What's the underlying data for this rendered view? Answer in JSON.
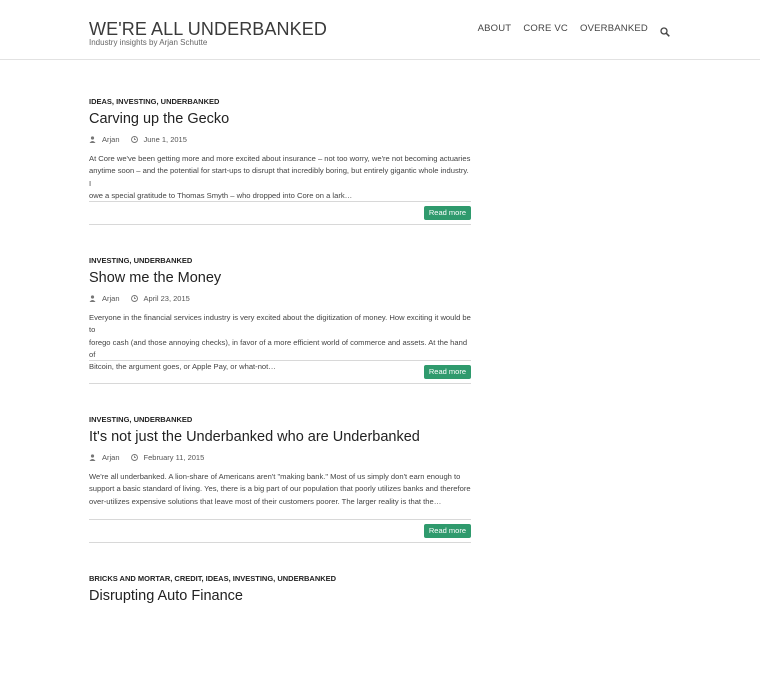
{
  "site": {
    "title": "WE'RE ALL UNDERBANKED",
    "tagline": "Industry insights by Arjan Schutte"
  },
  "nav": {
    "items": [
      "ABOUT",
      "CORE VC",
      "OVERBANKED"
    ],
    "search_icon": "search-icon"
  },
  "posts": [
    {
      "categories": "IDEAS, INVESTING, UNDERBANKED",
      "title": "Carving up the Gecko",
      "author": "Arjan",
      "date": "June 1, 2015",
      "excerpt_lines": [
        "At Core we've been getting more and more excited about insurance – not too worry, we're not becoming actuaries",
        "anytime soon – and the potential for start-ups to disrupt that incredibly boring, but entirely gigantic whole industry. I",
        "owe a special gratitude to Thomas Smyth – who dropped into Core on a lark…"
      ],
      "read_more": "Read more"
    },
    {
      "categories": "INVESTING, UNDERBANKED",
      "title": "Show me the Money",
      "author": "Arjan",
      "date": "April 23, 2015",
      "excerpt_lines": [
        "Everyone in the financial services industry is very excited about the digitization of money.  How exciting it would be to",
        "forego cash (and those annoying checks), in favor of a more efficient world of commerce and assets.  At the hand of",
        "Bitcoin, the argument goes, or Apple Pay, or what-not…"
      ],
      "read_more": "Read more"
    },
    {
      "categories": "INVESTING, UNDERBANKED",
      "title": "It's not just the Underbanked who are Underbanked",
      "author": "Arjan",
      "date": "February 11, 2015",
      "excerpt_lines": [
        "We're all underbanked.  A lion-share of Americans aren't \"making bank.\"  Most of us simply don't earn enough to",
        "support a basic standard of living.  Yes, there is a big part of our population that poorly utilizes banks and therefore",
        "over-utilizes expensive solutions that leave most of their customers poorer.  The larger reality is that the…"
      ],
      "read_more": "Read more"
    },
    {
      "categories": "BRICKS AND MORTAR, CREDIT, IDEAS, INVESTING, UNDERBANKED",
      "title": "Disrupting Auto Finance",
      "author": "",
      "date": "",
      "excerpt_lines": [],
      "read_more": ""
    }
  ],
  "colors": {
    "accent": "#2f9a6d",
    "text": "#333333",
    "rule": "#d8d8d8"
  }
}
